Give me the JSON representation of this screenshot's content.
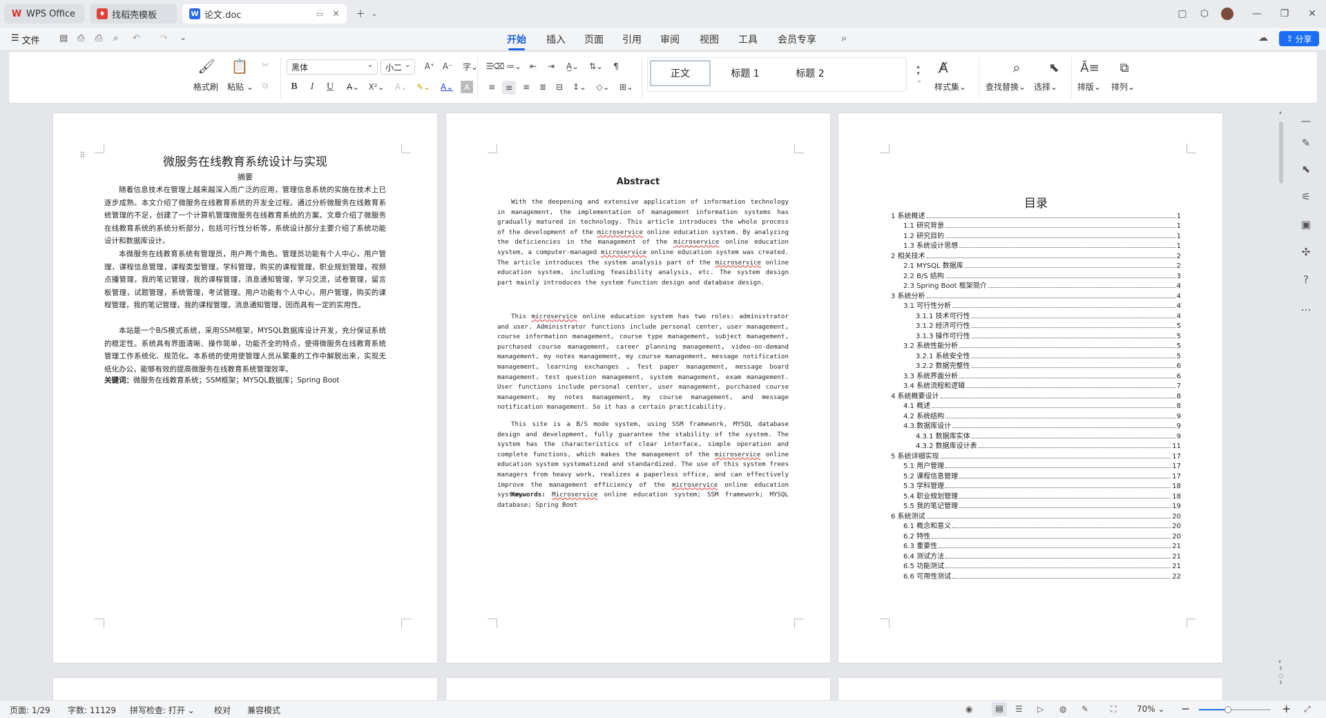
{
  "window": {
    "tabs": [
      {
        "label": "WPS Office"
      },
      {
        "label": "找稻壳模板"
      },
      {
        "label": "论文.doc"
      }
    ]
  },
  "menu": {
    "file": "文件",
    "items": [
      "开始",
      "插入",
      "页面",
      "引用",
      "审阅",
      "视图",
      "工具",
      "会员专享"
    ],
    "share": "分享"
  },
  "ribbon": {
    "format_painter": "格式刷",
    "paste": "粘贴",
    "font_name": "黑体",
    "font_size": "小二",
    "styles": [
      "正文",
      "标题 1",
      "标题 2"
    ],
    "style_set": "样式集",
    "find_replace": "查找替换",
    "select": "选择",
    "arrange1": "排版",
    "arrange2": "排列",
    "bold": "B",
    "italic": "I",
    "underline": "U"
  },
  "page1": {
    "title": "微服务在线教育系统设计与实现",
    "subtitle": "摘要",
    "p1": "随着信息技术在管理上越来越深入而广泛的应用，管理信息系统的实施在技术上已逐步成熟。本文介绍了微服务在线教育系统的开发全过程。通过分析微服务在线教育系统管理的不足，创建了一个计算机管理微服务在线教育系统的方案。文章介绍了微服务在线教育系统的系统分析部分，包括可行性分析等，系统设计部分主要介绍了系统功能设计和数据库设计。",
    "p2": "本微服务在线教育系统有管理员，用户两个角色。管理员功能有个人中心，用户管理，课程信息管理，课程类型管理，学科管理，购买的课程管理，职业规划管理，视频点播管理，我的笔记管理，我的课程管理，消息通知管理，学习交流，试卷管理，留言板管理，试题管理，系统管理，考试管理。用户功能有个人中心，用户管理，购买的课程管理，我的笔记管理，我的课程管理，消息通知管理，因而具有一定的实用性。",
    "p3": "本站是一个B/S模式系统，采用SSM框架，MYSQL数据库设计开发，充分保证系统的稳定性。系统具有界面清晰、操作简单，功能齐全的特点，使得微服务在线教育系统管理工作系统化、规范化。本系统的使用使管理人员从繁重的工作中解脱出来，实现无纸化办公，能够有效的提高微服务在线教育系统管理效率。",
    "kw_label": "关键词：",
    "kw": "微服务在线教育系统；SSM框架；MYSQL数据库；Spring Boot"
  },
  "page2": {
    "title": "Abstract",
    "p1a": "With the deepening and extensive application of information technology in management, the implementation of management information systems has gradually matured in technology. This article introduces the whole process of the development of the ",
    "ms": "microservice",
    "p1b": " online education system. By analyzing the deficiencies in the management of the ",
    "p1c": " online education system, a computer-managed ",
    "p1d": " online education system was created. The article introduces the system analysis part of the ",
    "p1e": " online education system, including feasibility analysis, etc. The system design part mainly introduces the system function design and database design.",
    "p2a": "This ",
    "p2b": " online education system has two roles: administrator and user. Administrator functions include personal center, user management, course information management, course type management, subject management, purchased course management, career planning management, video-on-demand management, my notes management, my course management, message notification management, learning exchanges , Test paper management, message board management, test question management, system management, exam management. User functions include personal center, user management, purchased course management, my notes management, my course management, and message notification management. So it has a certain practicability.",
    "p3a": "This site is a B/S mode system, using SSM framework, MYSQL database design and development, fully guarantee the stability of the system. The system has the characteristics of clear interface, simple operation and complete functions, which makes the management of the ",
    "p3b": " online education system systematized and standardized. The use of this system frees managers from heavy work, realizes a paperless office, and can effectively improve the management efficiency of the ",
    "p3c": " online education system.",
    "kw_label": "Keywords:",
    "kw_ms": "Microservice",
    "kw_rest": " online education system; SSM framework; MYSQL database; Spring Boot"
  },
  "page3": {
    "title": "目录",
    "toc": [
      {
        "t": "1 系统概述",
        "p": "1",
        "l": 0
      },
      {
        "t": "1.1 研究背景",
        "p": "1",
        "l": 1
      },
      {
        "t": "1.2 研究目的",
        "p": "1",
        "l": 1
      },
      {
        "t": "1.3 系统设计思想",
        "p": "1",
        "l": 1
      },
      {
        "t": "2 相关技术",
        "p": "2",
        "l": 0
      },
      {
        "t": "2.1 MYSQL 数据库",
        "p": "2",
        "l": 1
      },
      {
        "t": "2.2 B/S 结构",
        "p": "3",
        "l": 1
      },
      {
        "t": "2.3 Spring Boot 框架简介",
        "p": "4",
        "l": 1
      },
      {
        "t": "3 系统分析",
        "p": "4",
        "l": 0
      },
      {
        "t": "3.1 可行性分析",
        "p": "4",
        "l": 1
      },
      {
        "t": "3.1.1 技术可行性",
        "p": "4",
        "l": 2
      },
      {
        "t": "3.1.2 经济可行性",
        "p": "5",
        "l": 2
      },
      {
        "t": "3.1.3 操作可行性",
        "p": "5",
        "l": 2
      },
      {
        "t": "3.2 系统性能分析",
        "p": "5",
        "l": 1
      },
      {
        "t": "3.2.1 系统安全性",
        "p": "5",
        "l": 2
      },
      {
        "t": "3.2.2 数据完整性",
        "p": "6",
        "l": 2
      },
      {
        "t": "3.3 系统界面分析",
        "p": "6",
        "l": 1
      },
      {
        "t": "3.4 系统流程和逻辑",
        "p": "7",
        "l": 1
      },
      {
        "t": "4 系统概要设计",
        "p": "8",
        "l": 0
      },
      {
        "t": "4.1 概述",
        "p": "8",
        "l": 1
      },
      {
        "t": "4.2 系统结构",
        "p": "9",
        "l": 1
      },
      {
        "t": "4.3.数据库设计",
        "p": "9",
        "l": 1
      },
      {
        "t": "4.3.1 数据库实体",
        "p": "9",
        "l": 2
      },
      {
        "t": "4.3.2 数据库设计表",
        "p": "11",
        "l": 2
      },
      {
        "t": "5 系统详细实现",
        "p": "17",
        "l": 0
      },
      {
        "t": "5.1 用户管理",
        "p": "17",
        "l": 1
      },
      {
        "t": "5.2 课程信息管理",
        "p": "17",
        "l": 1
      },
      {
        "t": "5.3 学科管理",
        "p": "18",
        "l": 1
      },
      {
        "t": "5.4 职业规划管理",
        "p": "18",
        "l": 1
      },
      {
        "t": "5.5 我的笔记管理",
        "p": "19",
        "l": 1
      },
      {
        "t": "6 系统测试",
        "p": "20",
        "l": 0
      },
      {
        "t": "6.1 概念和意义",
        "p": "20",
        "l": 1
      },
      {
        "t": "6.2 特性",
        "p": "20",
        "l": 1
      },
      {
        "t": "6.3 重要性",
        "p": "21",
        "l": 1
      },
      {
        "t": "6.4 测试方法",
        "p": "21",
        "l": 1
      },
      {
        "t": "6.5  功能测试",
        "p": "21",
        "l": 1
      },
      {
        "t": "6.6 可用性测试",
        "p": "22",
        "l": 1
      }
    ]
  },
  "status": {
    "page": "页面: 1/29",
    "words": "字数: 11129",
    "spell": "拼写检查: 打开",
    "proof": "校对",
    "compat": "兼容模式",
    "zoom": "70%",
    "zoom_level": 0.4
  }
}
